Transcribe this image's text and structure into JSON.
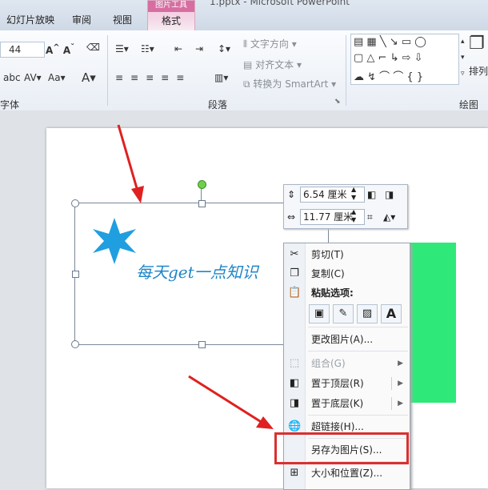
{
  "title_bar": {
    "tool_group": "图片工具",
    "file_title": "1.pptx - Microsoft PowerPoint"
  },
  "tabs": [
    "幻灯片放映",
    "审阅",
    "视图"
  ],
  "active_tab": "格式",
  "ribbon": {
    "font_size": "44",
    "group_font_label": "字体",
    "group_paragraph_label": "段落",
    "group_drawing_label": "绘图",
    "text_direction": "文字方向",
    "align_text": "对齐文本",
    "convert_smartart": "转换为 SmartArt",
    "arrange": "排列"
  },
  "slide": {
    "text": "每天get一点知识"
  },
  "mini_toolbar": {
    "height_value": "6.54 厘米",
    "width_value": "11.77 厘米"
  },
  "context_menu": {
    "cut": "剪切(T)",
    "copy": "复制(C)",
    "paste_options": "粘贴选项:",
    "change_picture": "更改图片(A)...",
    "group": "组合(G)",
    "bring_to_front": "置于顶层(R)",
    "send_to_back": "置于底层(K)",
    "hyperlink": "超链接(H)...",
    "save_as_picture": "另存为图片(S)...",
    "size_position": "大小和位置(Z)..."
  },
  "colors": {
    "accent": "#d93030",
    "shape_green": "#2ee879",
    "star_blue": "#1f9fe0",
    "text_blue": "#1f86c8"
  }
}
